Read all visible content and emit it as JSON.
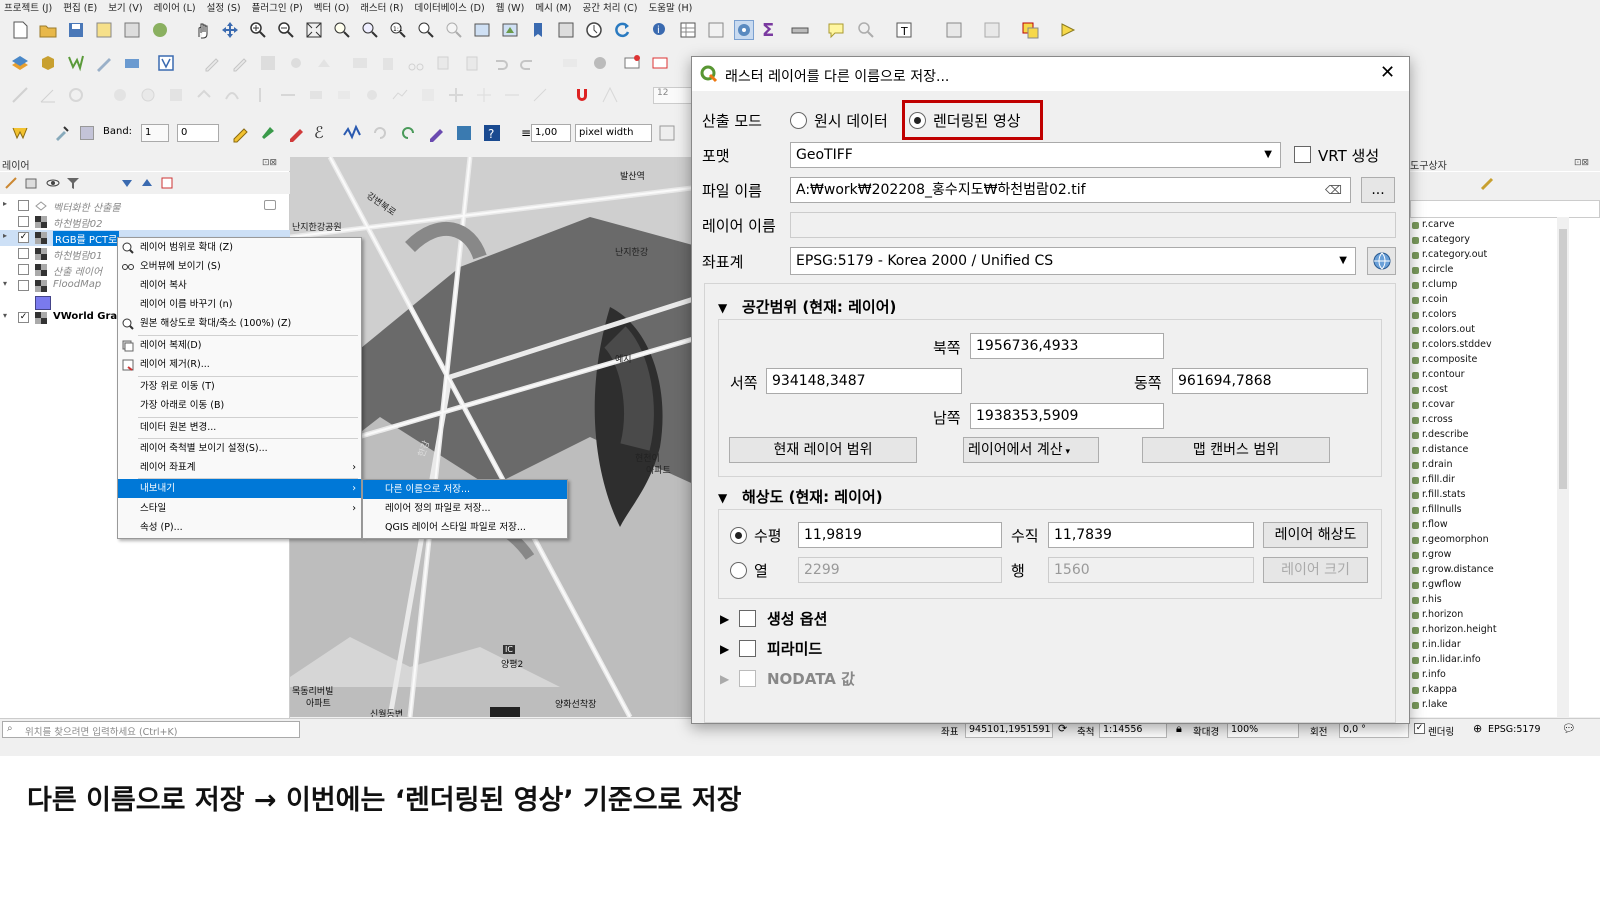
{
  "menubar": [
    "프로젝트 (J)",
    "편집 (E)",
    "보기 (V)",
    "레이어 (L)",
    "설정 (S)",
    "플러그인 (P)",
    "벡터 (O)",
    "래스터 (R)",
    "데이터베이스 (D)",
    "웹 (W)",
    "메시 (M)",
    "공간 처리 (C)",
    "도움말 (H)"
  ],
  "toolbar4": {
    "band_label": "Band:",
    "band_value": "1",
    "band_min": "0",
    "opacity": "1,00",
    "unit": "pixel width",
    "zoom_input": "12"
  },
  "layers_panel": {
    "title": "레이어",
    "rows": [
      {
        "label": "벡터화한 산출물",
        "checked": false
      },
      {
        "label": "하천범람02",
        "checked": false
      },
      {
        "label": "RGB를 PCT로",
        "checked": true
      },
      {
        "label": "하천범람01",
        "checked": false
      },
      {
        "label": "산출 레이어",
        "checked": false
      },
      {
        "label": "FloodMap",
        "checked": false
      },
      {
        "label": "VWorld Gray",
        "checked": true
      }
    ]
  },
  "context_menu": {
    "items": [
      "레이어 범위로 확대 (Z)",
      "오버뷰에 보이기 (S)",
      "레이어 복사",
      "레이어 이름 바꾸기 (n)",
      "원본 해상도로 확대/축소 (100%) (Z)",
      "레이어 복제(D)",
      "레이어 제거(R)...",
      "가장 위로 이동 (T)",
      "가장 아래로 이동 (B)",
      "데이터 원본 변경...",
      "레이어 축척별 보이기 설정(S)...",
      "레이어 좌표계",
      "내보내기",
      "스타일",
      "속성 (P)..."
    ],
    "submenu": [
      "다른 이름으로 저장...",
      "레이어 정의 파일로 저장...",
      "QGIS 레이어 스타일 파일로 저장..."
    ]
  },
  "map_labels": [
    "강변북로",
    "난지한강공원",
    "난지한강",
    "예지",
    "한강",
    "현천이",
    "아파트",
    "양평2",
    "목동리버빌",
    "아파트",
    "양화선착장",
    "신월동변",
    "IC",
    "발산역"
  ],
  "dialog": {
    "title": "래스터 레이어를 다른 이름으로 저장...",
    "output_mode_label": "산출 모드",
    "raw_data": "원시 데이터",
    "rendered_image": "렌더링된 영상",
    "format_label": "포맷",
    "format_value": "GeoTIFF",
    "vrt_label": "VRT 생성",
    "filename_label": "파일 이름",
    "filename_value": "A:₩work₩202208_홍수지도₩하천범람02.tif",
    "browse": "...",
    "layername_label": "레이어 이름",
    "layername_value": "",
    "crs_label": "좌표계",
    "crs_value": "EPSG:5179 - Korea 2000 / Unified CS",
    "extent": {
      "title": "공간범위 (현재: 레이어)",
      "north_label": "북쪽",
      "north": "1956736,4933",
      "west_label": "서쪽",
      "west": "934148,3487",
      "east_label": "동쪽",
      "east": "961694,7868",
      "south_label": "남쪽",
      "south": "1938353,5909",
      "btn_current": "현재 레이어 범위",
      "btn_calc": "레이어에서 계산",
      "btn_canvas": "맵 캔버스 범위"
    },
    "resolution": {
      "title": "해상도 (현재: 레이어)",
      "horiz_label": "수평",
      "horiz": "11,9819",
      "vert_label": "수직",
      "vert": "11,7839",
      "btn_layer_res": "레이어 해상도",
      "cols_label": "열",
      "cols": "2299",
      "rows_label": "행",
      "rows": "1560",
      "btn_layer_size": "레이어 크기"
    },
    "create_options": "생성 옵션",
    "pyramids": "피라미드",
    "nodata": "NODATA 값",
    "highlight_color": "#c00000"
  },
  "processing": {
    "title": "도구상자",
    "algorithms": [
      "r.carve",
      "r.category",
      "r.category.out",
      "r.circle",
      "r.clump",
      "r.coin",
      "r.colors",
      "r.colors.out",
      "r.colors.stddev",
      "r.composite",
      "r.contour",
      "r.cost",
      "r.covar",
      "r.cross",
      "r.describe",
      "r.distance",
      "r.drain",
      "r.fill.dir",
      "r.fill.stats",
      "r.fillnulls",
      "r.flow",
      "r.geomorphon",
      "r.grow",
      "r.grow.distance",
      "r.gwflow",
      "r.his",
      "r.horizon",
      "r.horizon.height",
      "r.in.lidar",
      "r.in.lidar.info",
      "r.info",
      "r.kappa",
      "r.lake"
    ]
  },
  "statusbar": {
    "search_placeholder": "위치를 찾으려면 입력하세요 (Ctrl+K)",
    "coord_label": "좌표",
    "coord": "945101,1951591",
    "scale_label": "축척",
    "scale": "1:14556",
    "magnifier_label": "확대경",
    "magnifier": "100%",
    "rotation_label": "회전",
    "rotation": "0,0 °",
    "render_label": "렌더링",
    "crs": "EPSG:5179"
  },
  "caption": "다른 이름으로 저장 → 이번에는 ‘렌더링된 영상’ 기준으로 저장"
}
